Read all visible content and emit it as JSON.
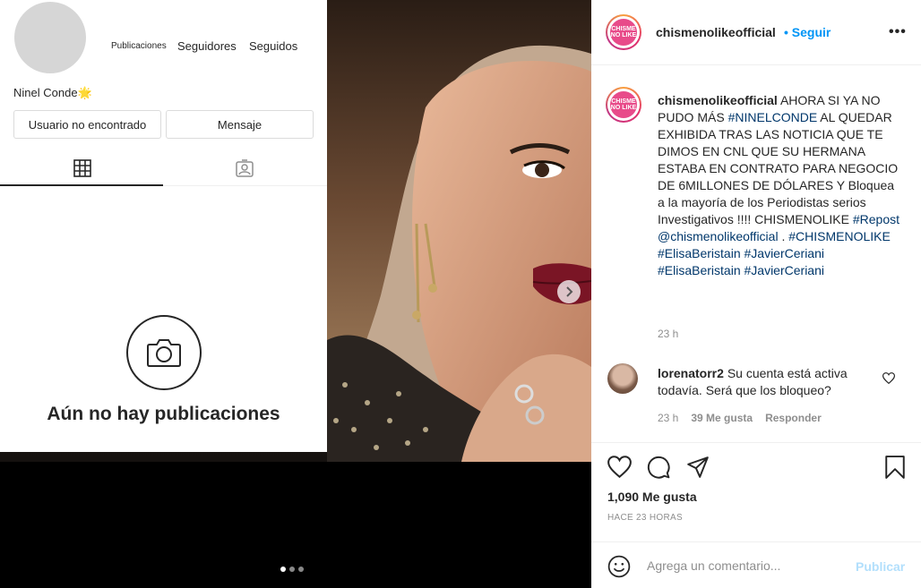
{
  "profile_inset": {
    "stat_publicaciones": "Publicaciones",
    "stat_seguidores": "Seguidores",
    "stat_seguidos": "Seguidos",
    "name": "Ninel Conde🌟",
    "btn_user": "Usuario no encontrado",
    "btn_message": "Mensaje",
    "empty_text": "Aún no hay publicaciones"
  },
  "header": {
    "username": "chismenolikeofficial",
    "follow": "• Seguir",
    "more": "•••",
    "logo_text": "CHISME NO LIKE"
  },
  "caption": {
    "username": "chismenolikeofficial",
    "text": "AHORA SI YA NO PUDO MÁS",
    "tag1": "#NINELCONDE",
    "text2": "AL QUEDAR EXHIBIDA TRAS LAS NOTICIA QUE TE DIMOS EN CNL QUE SU HERMANA ESTABA EN CONTRATO PARA NEGOCIO DE 6MILLONES DE DÓLARES Y Bloquea a la mayoría de los Periodistas serios Investigativos !!!! CHISMENOLIKE",
    "tag2": "#Repost",
    "mention": "@chismenolikeofficial",
    "dot": ".",
    "tag3": "#CHISMENOLIKE",
    "tag4": "#ElisaBeristain",
    "tag5": "#JavierCeriani",
    "tag6": "#ElisaBeristain",
    "tag7": "#JavierCeriani",
    "time": "23 h"
  },
  "comment": {
    "username": "lorenatorr2",
    "text": "Su cuenta está activa todavía. Será que los bloqueo?",
    "time": "23 h",
    "likes": "39 Me gusta",
    "reply": "Responder"
  },
  "actions": {
    "likes": "1,090 Me gusta",
    "ago": "HACE 23 HORAS",
    "comment_placeholder": "Agrega un comentario...",
    "publish": "Publicar"
  },
  "carousel": {
    "current": 1,
    "total": 3
  }
}
